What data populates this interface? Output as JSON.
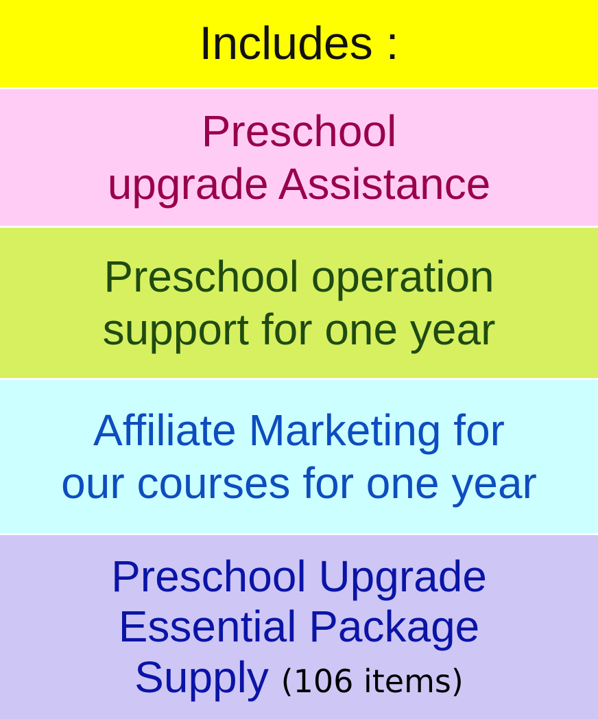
{
  "header": {
    "text": "Includes :",
    "background": "#ffff00",
    "color": "#111111"
  },
  "sections": [
    {
      "lines": [
        "Preschool",
        "upgrade Assistance"
      ],
      "background": "#ffccf5",
      "color": "#99004c"
    },
    {
      "lines": [
        "Preschool operation",
        "support for one year"
      ],
      "background": "#d6f060",
      "color": "#1f4a10"
    },
    {
      "lines": [
        "Affiliate Marketing for",
        "our courses for one year"
      ],
      "background": "#ccffff",
      "color": "#0d4dbf"
    },
    {
      "lines": [
        "Preschool Upgrade",
        "Essential Package",
        "Supply"
      ],
      "note": "(106 items)",
      "background": "#cec6f5",
      "color": "#0a14a6"
    }
  ]
}
